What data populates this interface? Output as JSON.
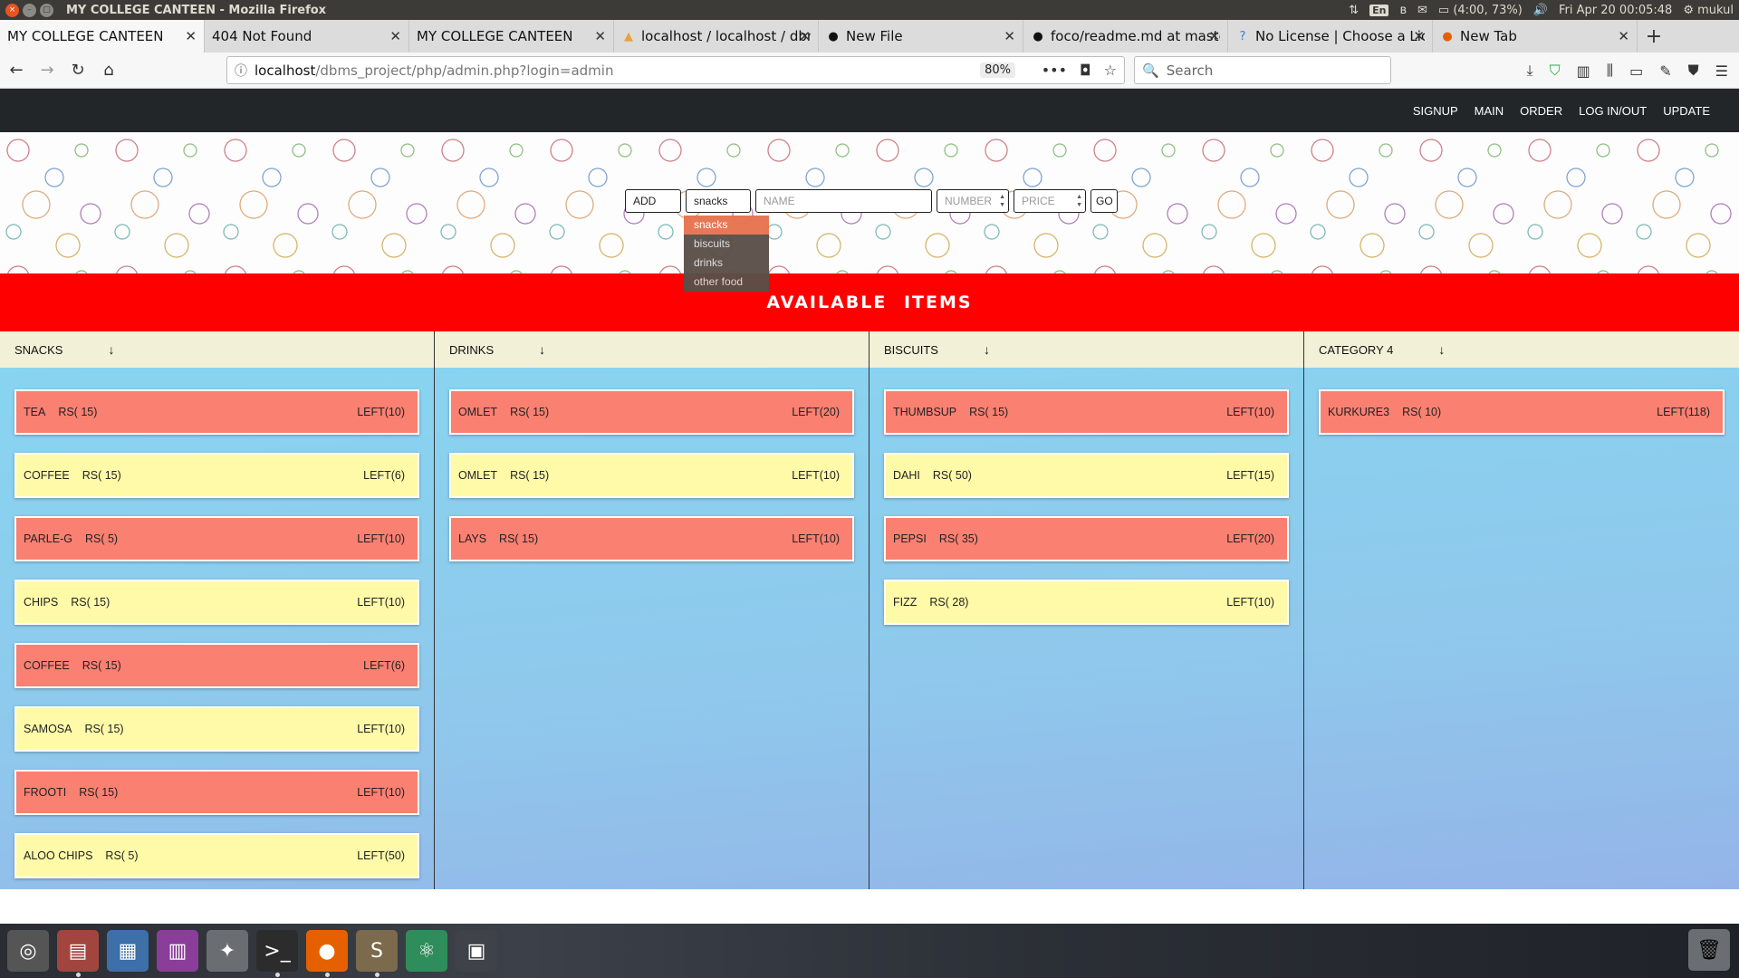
{
  "os": {
    "window_title": "MY COLLEGE CANTEEN - Mozilla Firefox",
    "keyboard": "En",
    "battery": "(4:00, 73%)",
    "datetime": "Fri Apr 20 00:05:48",
    "user": "mukul"
  },
  "tabs": [
    {
      "label": "MY COLLEGE CANTEEN",
      "icon": "none",
      "active": true
    },
    {
      "label": "404 Not Found",
      "icon": "none",
      "active": false
    },
    {
      "label": "MY COLLEGE CANTEEN",
      "icon": "none",
      "active": false
    },
    {
      "label": "localhost / localhost / dbms_project",
      "icon": "phpmyadmin-icon",
      "active": false
    },
    {
      "label": "New File",
      "icon": "github-icon",
      "active": false
    },
    {
      "label": "foco/readme.md at master",
      "icon": "github-icon",
      "active": false
    },
    {
      "label": "No License | Choose a License",
      "icon": "choosealicense-icon",
      "active": false
    },
    {
      "label": "New Tab",
      "icon": "firefox-icon",
      "active": false
    }
  ],
  "navbar": {
    "url_host": "localhost",
    "url_path": "/dbms_project/php/admin.php?login=admin",
    "zoom": "80%",
    "search_placeholder": "Search"
  },
  "site_nav": [
    "SIGNUP",
    "MAIN",
    "ORDER",
    "LOG IN/OUT",
    "UPDATE"
  ],
  "add_form": {
    "action": "ADD",
    "category_selected": "snacks",
    "name_placeholder": "NAME",
    "number_placeholder": "NUMBER",
    "price_placeholder": "PRICE",
    "go_label": "GO",
    "category_options": [
      "snacks",
      "biscuits",
      "drinks",
      "other food"
    ]
  },
  "available_title": "AVAILABLE ITEMS",
  "columns": [
    {
      "title": "SNACKS",
      "items": [
        {
          "name": "TEA",
          "price": "RS( 15)",
          "left": "LEFT(10)",
          "color": "red"
        },
        {
          "name": "COFFEE",
          "price": "RS( 15)",
          "left": "LEFT(6)",
          "color": "yellow"
        },
        {
          "name": "PARLE-G",
          "price": "RS( 5)",
          "left": "LEFT(10)",
          "color": "red"
        },
        {
          "name": "CHIPS",
          "price": "RS( 15)",
          "left": "LEFT(10)",
          "color": "yellow"
        },
        {
          "name": "COFFEE",
          "price": "RS( 15)",
          "left": "LEFT(6)",
          "color": "red"
        },
        {
          "name": "SAMOSA",
          "price": "RS( 15)",
          "left": "LEFT(10)",
          "color": "yellow"
        },
        {
          "name": "FROOTI",
          "price": "RS( 15)",
          "left": "LEFT(10)",
          "color": "red"
        },
        {
          "name": "ALOO CHIPS",
          "price": "RS( 5)",
          "left": "LEFT(50)",
          "color": "yellow"
        }
      ]
    },
    {
      "title": "DRINKS",
      "items": [
        {
          "name": "OMLET",
          "price": "RS( 15)",
          "left": "LEFT(20)",
          "color": "red"
        },
        {
          "name": "OMLET",
          "price": "RS( 15)",
          "left": "LEFT(10)",
          "color": "yellow"
        },
        {
          "name": "LAYS",
          "price": "RS( 15)",
          "left": "LEFT(10)",
          "color": "red"
        }
      ]
    },
    {
      "title": "BISCUITS",
      "items": [
        {
          "name": "THUMBSUP",
          "price": "RS( 15)",
          "left": "LEFT(10)",
          "color": "red"
        },
        {
          "name": "DAHI",
          "price": "RS( 50)",
          "left": "LEFT(15)",
          "color": "yellow"
        },
        {
          "name": "PEPSI",
          "price": "RS( 35)",
          "left": "LEFT(20)",
          "color": "red"
        },
        {
          "name": "FIZZ",
          "price": "RS( 28)",
          "left": "LEFT(10)",
          "color": "yellow"
        }
      ]
    },
    {
      "title": "CATEGORY 4",
      "items": [
        {
          "name": "KURKURE3",
          "price": "RS( 10)",
          "left": "LEFT(118)",
          "color": "red"
        }
      ]
    }
  ],
  "colors": {
    "accent_red": "#ff0000",
    "item_red": "#fa8072",
    "item_yellow": "#fffaa8",
    "nav_dark": "#222629"
  },
  "taskbar": [
    "ubuntu-dash-icon",
    "files-icon",
    "text-editor-icon",
    "app-icon",
    "settings-icon",
    "terminal-icon",
    "firefox-icon",
    "sublime-text-icon",
    "atom-icon",
    "workspace-icon"
  ]
}
